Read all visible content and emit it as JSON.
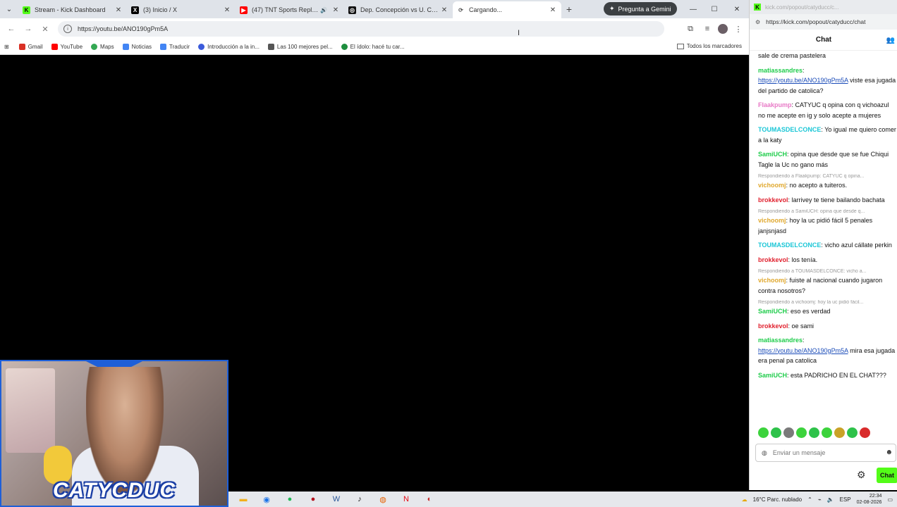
{
  "browser": {
    "tabs": [
      {
        "title": "Stream - Kick Dashboard",
        "color": "#53fc18",
        "glyph": "K"
      },
      {
        "title": "(3) Inicio / X",
        "color": "#000000",
        "glyph": "X"
      },
      {
        "title": "(47) TNT Sports Replay | C",
        "color": "#ff0000",
        "glyph": "▶"
      },
      {
        "title": "Dep. Concepción vs U. Católi",
        "color": "#111111",
        "glyph": "◎"
      },
      {
        "title": "Cargando...",
        "color": "#ffffff",
        "glyph": "⟳"
      }
    ],
    "new_tab": "+",
    "gemini_label": "Pregunta a Gemini",
    "url": "https://youtu.be/ANO190gPm5A",
    "bookmarks": [
      {
        "label": "Gmail",
        "color": "#d93025"
      },
      {
        "label": "YouTube",
        "color": "#ff0000"
      },
      {
        "label": "Maps",
        "color": "#34a853"
      },
      {
        "label": "Noticias",
        "color": "#4285f4"
      },
      {
        "label": "Traducir",
        "color": "#4285f4"
      },
      {
        "label": "Introducción a la in...",
        "color": "#3b5bdb"
      },
      {
        "label": "Las 100 mejores pel...",
        "color": "#555555"
      },
      {
        "label": "El ídolo: hacé tu car...",
        "color": "#1e8e3e"
      }
    ],
    "all_bookmarks": "Todos los marcadores"
  },
  "webcam": {
    "logo_text": "CATYCDUC"
  },
  "chat": {
    "window_url_faded": "kick.com/popout/catyducc/c...",
    "url": "https://kick.com/popout/catyducc/chat",
    "header": "Chat",
    "messages": [
      {
        "type": "msg",
        "user": "",
        "color": "#111111",
        "text": "sale de crema pastelera"
      },
      {
        "type": "msg",
        "user": "matiassandres",
        "color": "#1ecc4a",
        "link": "https://youtu.be/ANO190gPm5A",
        "text": "viste esa jugada del partido de catolica?"
      },
      {
        "type": "msg",
        "user": "Flaakpump",
        "color": "#e879c6",
        "text": "CATYUC q opina con q vichoazul no me acepte en ig y solo acepte a mujeres"
      },
      {
        "type": "msg",
        "user": "TOUMASDELCONCE",
        "color": "#1ac6d6",
        "text": "Yo igual me quiero comer a la katy"
      },
      {
        "type": "msg",
        "user": "SamiUCH",
        "color": "#1ecc4a",
        "text": "opina que desde que se fue Chiqui Tagle la Uc no gano más"
      },
      {
        "type": "reply",
        "text": "Respondiendo a Flaakpump: CATYUC q opina..."
      },
      {
        "type": "msg",
        "user": "vichoomj",
        "color": "#e0a82e",
        "text": "no acepto a tuiteros."
      },
      {
        "type": "msg",
        "user": "brokkevol",
        "color": "#e0222f",
        "text": "larrivey te tiene bailando bachata"
      },
      {
        "type": "reply",
        "text": "Respondiendo a SamiUCH: opina que desde q..."
      },
      {
        "type": "msg",
        "user": "vichoomj",
        "color": "#e0a82e",
        "text": "hoy la uc pidió fácil 5 penales janjsnjasd"
      },
      {
        "type": "msg",
        "user": "TOUMASDELCONCE",
        "color": "#1ac6d6",
        "text": "vicho azul cállate perkin"
      },
      {
        "type": "msg",
        "user": "brokkevol",
        "color": "#e0222f",
        "text": "los tenía."
      },
      {
        "type": "reply",
        "text": "Respondiendo a TOUMASDELCONCE: vicho a..."
      },
      {
        "type": "msg",
        "user": "vichoomj",
        "color": "#e0a82e",
        "text": "fuiste al nacional cuando jugaron contra nosotros?"
      },
      {
        "type": "reply",
        "text": "Respondiendo a vichoomj: hoy la uc pidió fácil..."
      },
      {
        "type": "msg",
        "user": "SamiUCH",
        "color": "#1ecc4a",
        "text": "eso es verdad"
      },
      {
        "type": "msg",
        "user": "brokkevol",
        "color": "#e0222f",
        "text": "oe sami"
      },
      {
        "type": "msg",
        "user": "matiassandres",
        "color": "#1ecc4a",
        "link": "https://youtu.be/ANO190gPm5A",
        "text": "mira esa jugada era penal pa catolica"
      },
      {
        "type": "msg",
        "user": "SamiUCH",
        "color": "#1ecc4a",
        "text": "esta PADRICHO EN EL CHAT???"
      }
    ],
    "emote_colors": [
      "#3cd33c",
      "#2ec24a",
      "#7a7a7a",
      "#3cd33c",
      "#2ec24a",
      "#3cd33c",
      "#c9a227",
      "#2ec24a",
      "#d92b2b"
    ],
    "input_placeholder": "Enviar un mensaje",
    "send_label": "Chat"
  },
  "taskbar": {
    "weather": "16°C  Parc. nublado",
    "lang": "ESP",
    "time": "22:34",
    "date": "02-08-2026",
    "apps": [
      {
        "name": "file-explorer-icon",
        "glyph": "▬",
        "color": "#f2b01e"
      },
      {
        "name": "chrome-icon",
        "glyph": "◉",
        "color": "#1a73e8"
      },
      {
        "name": "spotify-icon",
        "glyph": "●",
        "color": "#1db954"
      },
      {
        "name": "record-icon",
        "glyph": "●",
        "color": "#b3121e"
      },
      {
        "name": "word-icon",
        "glyph": "W",
        "color": "#2b579a"
      },
      {
        "name": "tiktok-icon",
        "glyph": "♪",
        "color": "#111111"
      },
      {
        "name": "firefox-icon",
        "glyph": "◍",
        "color": "#e66000"
      },
      {
        "name": "netflix-icon",
        "glyph": "N",
        "color": "#e50914"
      },
      {
        "name": "obs-icon",
        "glyph": "◐",
        "color": "#c62828"
      }
    ]
  }
}
